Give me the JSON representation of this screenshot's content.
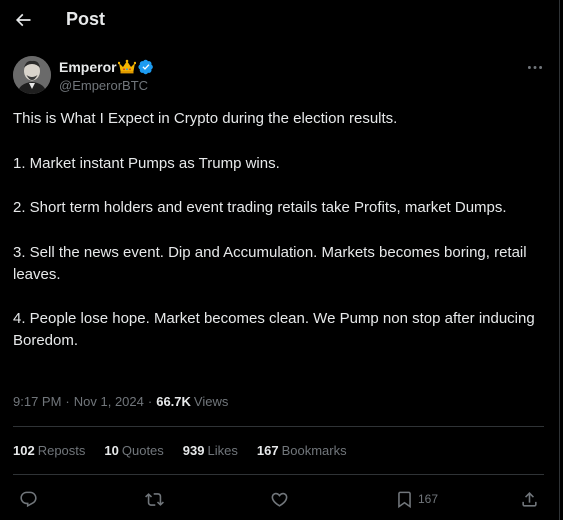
{
  "header": {
    "title": "Post"
  },
  "author": {
    "display_name": "Emperor",
    "handle": "@EmperorBTC"
  },
  "tweet": {
    "paragraphs": [
      "This is What I Expect in Crypto during the election results.",
      "1. Market instant Pumps as Trump wins.",
      "2. Short term holders and event trading retails take Profits, market Dumps.",
      "3. Sell the news event. Dip and Accumulation. Markets becomes boring, retail leaves.",
      "4. People lose hope. Market becomes clean. We Pump non stop after inducing Boredom."
    ]
  },
  "meta": {
    "time": "9:17 PM",
    "date": "Nov 1, 2024",
    "separator": "·",
    "views_count": "66.7K",
    "views_label": "Views"
  },
  "stats": {
    "reposts": {
      "count": "102",
      "label": "Reposts"
    },
    "quotes": {
      "count": "10",
      "label": "Quotes"
    },
    "likes": {
      "count": "939",
      "label": "Likes"
    },
    "bookmarks": {
      "count": "167",
      "label": "Bookmarks"
    }
  },
  "actions": {
    "bookmark_count": "167"
  },
  "icons": {
    "back": "arrow-left-icon",
    "more": "more-horizontal-icon",
    "verified": "verified-badge-icon",
    "crown": "crown-icon",
    "reply": "reply-icon",
    "retweet": "retweet-icon",
    "like": "heart-icon",
    "bookmark": "bookmark-icon",
    "share": "share-icon"
  },
  "colors": {
    "background": "#000000",
    "text_primary": "#e7e9ea",
    "text_secondary": "#71767b",
    "divider": "#2f3336",
    "verified_blue": "#1d9bf0",
    "crown_gold": "#f4b400"
  }
}
